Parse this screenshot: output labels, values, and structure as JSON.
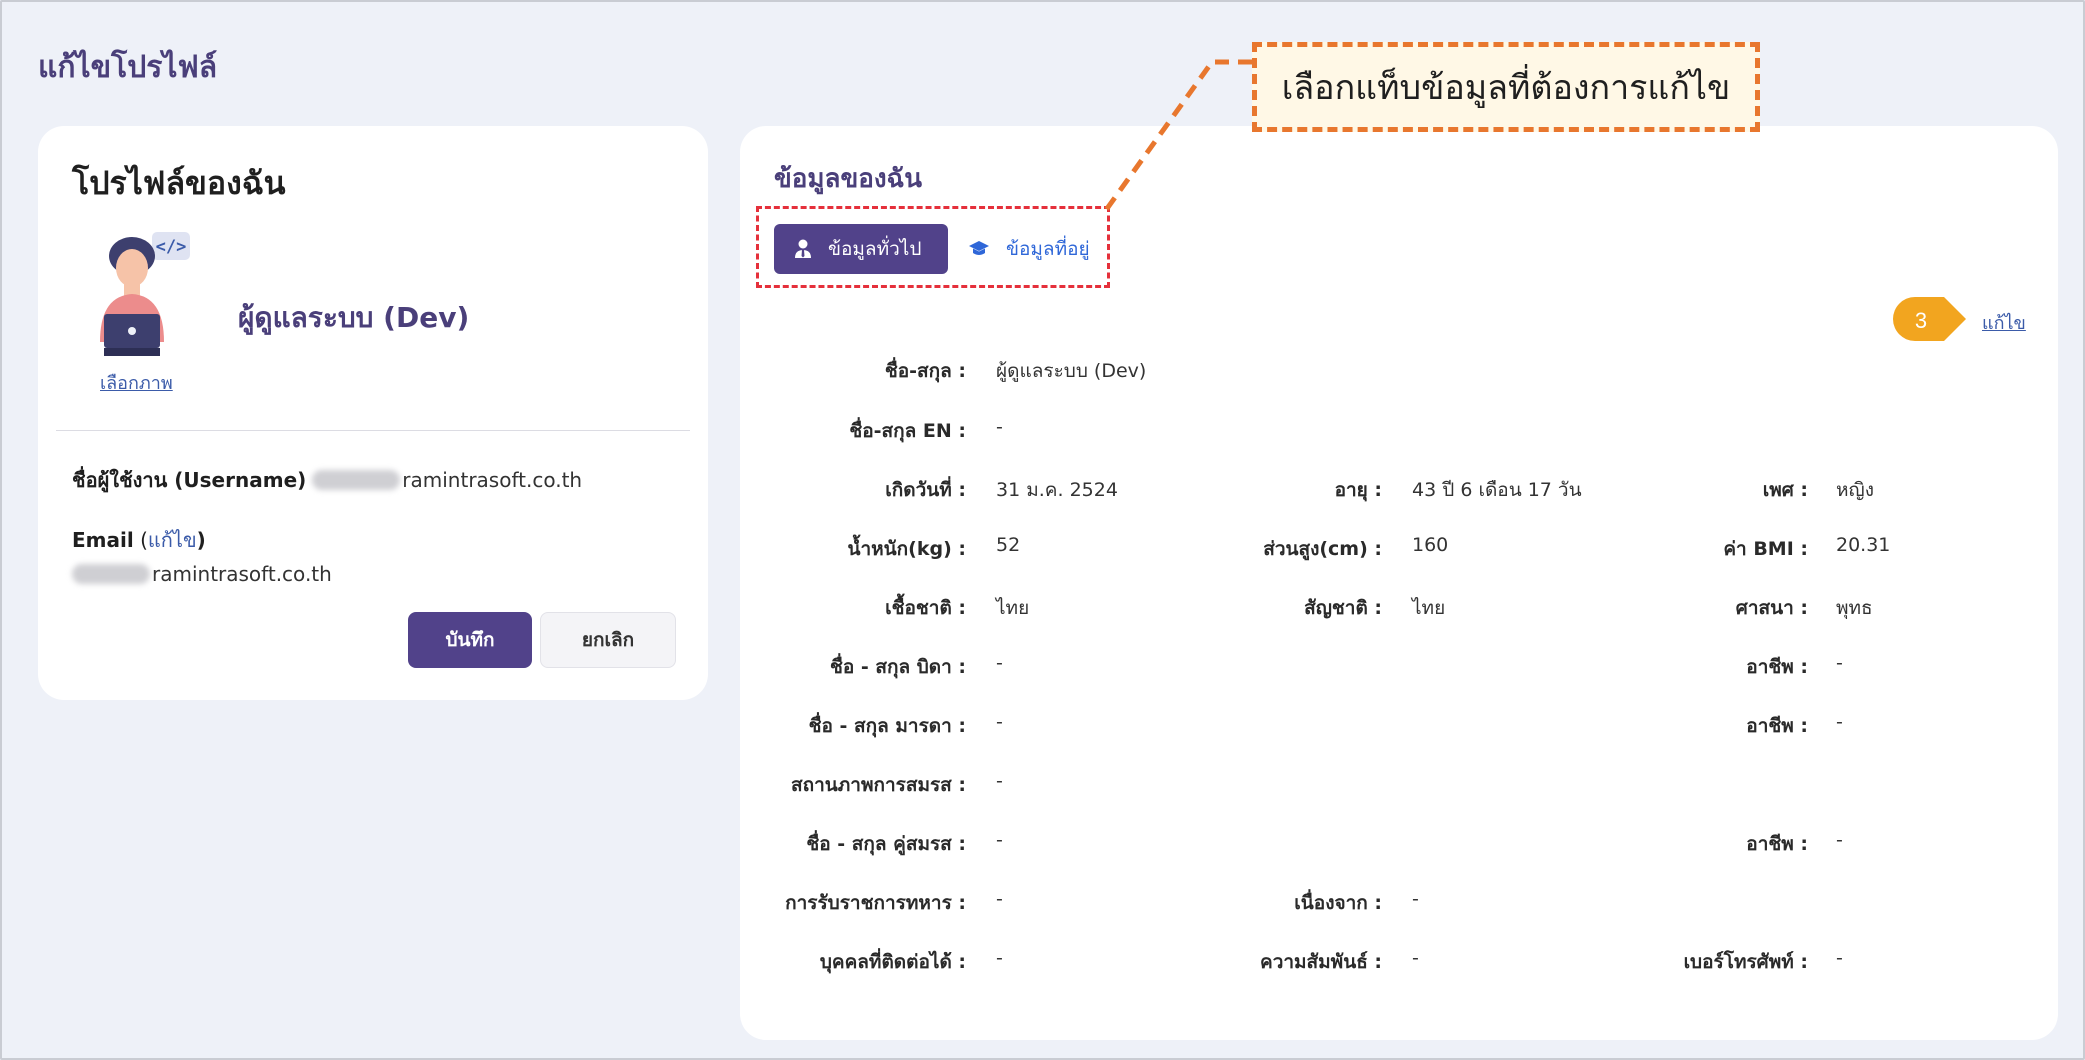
{
  "page": {
    "title": "แก้ไขโปรไฟล์"
  },
  "profile_card": {
    "title": "โปรไฟล์ของฉัน",
    "avatar_link": "เลือกภาพ",
    "display_name": "ผู้ดูแลระบบ (Dev)",
    "username_label": "ชื่อผู้ใช้งาน (Username)",
    "username_value": "ramintrasoft.co.th",
    "email_label": "Email",
    "email_edit_open": " (",
    "email_edit": "แก้ไข",
    "email_edit_close": ")",
    "email_value": "ramintrasoft.co.th",
    "save_label": "บันทึก",
    "cancel_label": "ยกเลิก"
  },
  "info_card": {
    "title": "ข้อมูลของฉัน",
    "tabs": [
      {
        "label": "ข้อมูลทั่วไป",
        "active": true
      },
      {
        "label": "ข้อมูลที่อยู่",
        "active": false
      }
    ],
    "edit_label": "แก้ไข",
    "step_number": "3",
    "fields": {
      "name_label": "ชื่อ-สกุล :",
      "name": "ผู้ดูแลระบบ (Dev)",
      "name_en_label": "ชื่อ-สกุล EN :",
      "name_en": "-",
      "birth_label": "เกิดวันที่ :",
      "birth": "31 ม.ค. 2524",
      "age_label": "อายุ :",
      "age": "43 ปี 6 เดือน 17 วัน",
      "sex_label": "เพศ :",
      "sex": "หญิง",
      "weight_label": "น้ำหนัก(kg) :",
      "weight": "52",
      "height_label": "ส่วนสูง(cm) :",
      "height": "160",
      "bmi_label": "ค่า BMI :",
      "bmi": "20.31",
      "race_label": "เชื้อชาติ :",
      "race": "ไทย",
      "nationality_label": "สัญชาติ :",
      "nationality": "ไทย",
      "religion_label": "ศาสนา :",
      "religion": "พุทธ",
      "father_label": "ชื่อ - สกุล บิดา :",
      "father": "-",
      "father_job_label": "อาชีพ :",
      "father_job": "-",
      "mother_label": "ชื่อ - สกุล มารดา :",
      "mother": "-",
      "mother_job_label": "อาชีพ :",
      "mother_job": "-",
      "marital_label": "สถานภาพการสมรส :",
      "marital": "-",
      "spouse_label": "ชื่อ - สกุล คู่สมรส :",
      "spouse": "-",
      "spouse_job_label": "อาชีพ :",
      "spouse_job": "-",
      "military_label": "การรับราชการทหาร :",
      "military": "-",
      "reason_label": "เนื่องจาก :",
      "reason": "-",
      "contact_label": "บุคคลที่ติดต่อได้ :",
      "contact": "-",
      "relation_label": "ความสัมพันธ์ :",
      "relation": "-",
      "phone_label": "เบอร์โทรศัพท์ :",
      "phone": "-"
    }
  },
  "callout": {
    "text": "เลือกแท็บข้อมูลที่ต้องการแก้ไข"
  },
  "colors": {
    "primary": "#51428a",
    "accent": "#e8772e",
    "marker": "#f2a51f",
    "dash_red": "#e5303b"
  }
}
